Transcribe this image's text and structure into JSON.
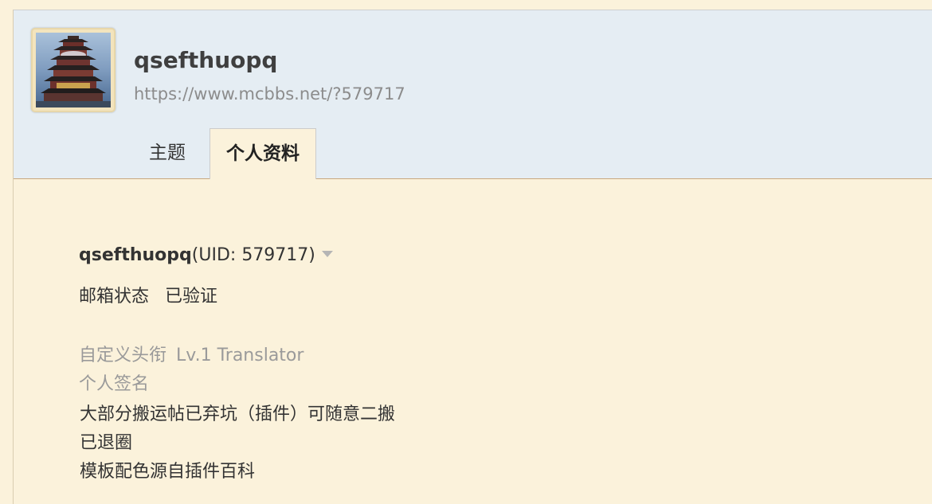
{
  "header": {
    "username": "qsefthuopq",
    "url": "https://www.mcbbs.net/?579717"
  },
  "tabs": [
    {
      "label": "主题",
      "active": false
    },
    {
      "label": "个人资料",
      "active": true
    }
  ],
  "profile": {
    "name": "qsefthuopq",
    "uid_text": "(UID: 579717)",
    "email_label": "邮箱状态",
    "email_value": "已验证",
    "custom_title_label": "自定义头衔",
    "custom_title_value": "Lv.1 Translator",
    "signature_label": "个人签名",
    "signature_lines": [
      "大部分搬运帖已弃坑（插件）可随意二搬",
      "已退圈",
      "模板配色源自插件百科"
    ]
  },
  "colors": {
    "page_bg": "#fbf2db",
    "header_bg": "#e5edf3",
    "header_border": "#c9a77e"
  }
}
